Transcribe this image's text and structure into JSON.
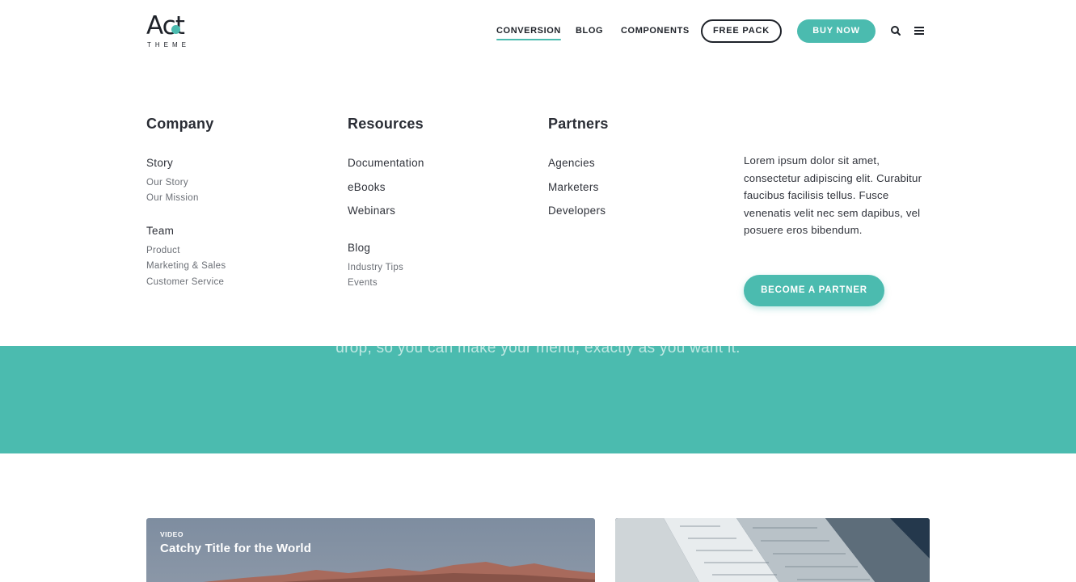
{
  "header": {
    "logo": {
      "word": "Act",
      "sub": "THEME"
    },
    "nav": [
      {
        "label": "CONVERSION",
        "active": true
      },
      {
        "label": "BLOG",
        "active": false
      },
      {
        "label": "COMPONENTS",
        "active": false
      }
    ],
    "free_pack_label": "FREE PACK",
    "buy_now_label": "BUY NOW",
    "icons": {
      "search": "search-icon",
      "menu": "hamburger-menu-icon"
    }
  },
  "mega_menu": {
    "company": {
      "title": "Company",
      "groups": [
        {
          "label": "Story",
          "items": [
            "Our Story",
            "Our Mission"
          ]
        },
        {
          "label": "Team",
          "items": [
            "Product",
            "Marketing & Sales",
            "Customer Service"
          ]
        }
      ]
    },
    "resources": {
      "title": "Resources",
      "items": [
        "Documentation",
        "eBooks",
        "Webinars"
      ],
      "blog": {
        "label": "Blog",
        "items": [
          "Industry Tips",
          "Events"
        ]
      }
    },
    "partners": {
      "title": "Partners",
      "items": [
        "Agencies",
        "Marketers",
        "Developers"
      ]
    },
    "promo": {
      "text": "Lorem ipsum dolor sit amet, consectetur adipiscing elit. Curabitur faucibus facilisis tellus. Fusce venenatis velit nec sem dapibus, vel posuere eros bibendum.",
      "button_label": "BECOME A PARTNER"
    }
  },
  "hero": {
    "text": "drop, so you can make your menu, exactly as you want it."
  },
  "cards": [
    {
      "tag": "VIDEO",
      "title": "Catchy Title for the World"
    },
    {
      "tag": "",
      "title": ""
    }
  ],
  "colors": {
    "accent": "#4bbbaf",
    "text": "#1e2229"
  }
}
